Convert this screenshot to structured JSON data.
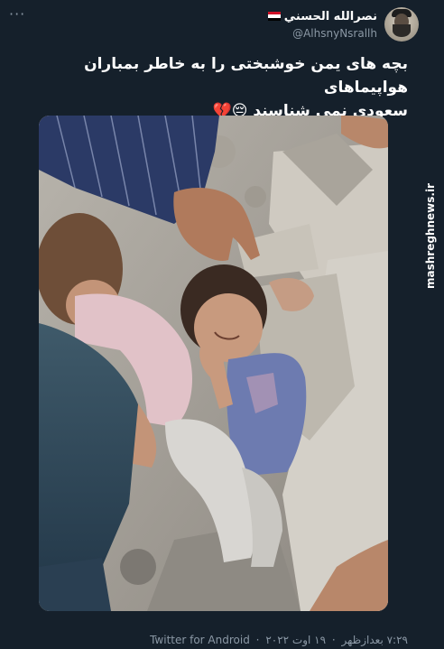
{
  "tweet": {
    "more_label": "···",
    "author": {
      "display_name": "نصرالله الحسني",
      "handle": "@AlhsnyNsrallh",
      "flag_colors": [
        "#ce1126",
        "#ffffff",
        "#000000"
      ]
    },
    "text_line1": "بچه های یمن خوشبختی را به خاطر بمباران هواپیماهای",
    "text_line2": "سعودی نمی شناسند",
    "emojis": "😔💔",
    "media": {
      "alt": "photo"
    },
    "time": "۷:۲۹ بعدازظهر",
    "date": "۱۹ اوت ۲۰۲۲",
    "source": "Twitter for Android",
    "separator": "·"
  },
  "watermark": "mashreghnews.ir",
  "colors": {
    "background": "#15202b",
    "text": "#ffffff",
    "secondary": "#8b98a5"
  }
}
